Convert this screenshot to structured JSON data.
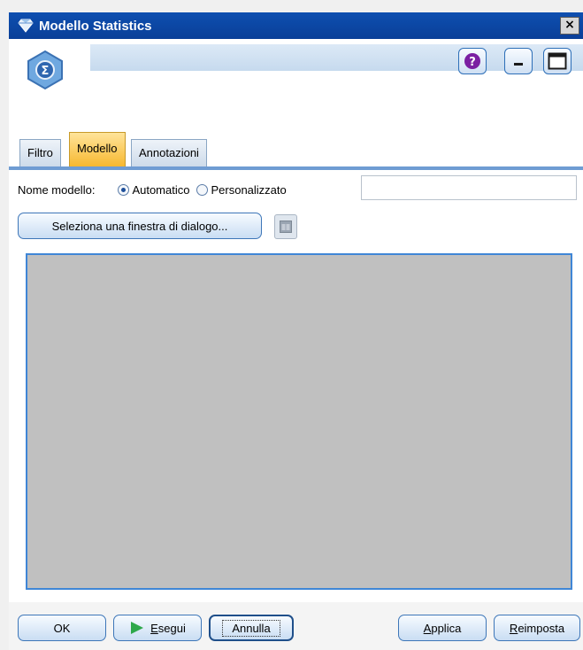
{
  "window": {
    "title": "Modello Statistics",
    "close_glyph": "×"
  },
  "header": {
    "node_icon": "sigma-node-icon",
    "help_icon": "help-icon",
    "minimize_icon": "minimize-icon",
    "maximize_icon": "maximize-icon"
  },
  "tabs": [
    {
      "label": "Filtro",
      "active": false
    },
    {
      "label": "Modello",
      "active": true
    },
    {
      "label": "Annotazioni",
      "active": false
    }
  ],
  "model": {
    "name_label": "Nome modello:",
    "radio_auto": "Automatico",
    "radio_custom": "Personalizzato",
    "selected": "Automatico",
    "custom_name_value": "",
    "select_dialog_button": "Seleziona una finestra di dialogo..."
  },
  "footer": {
    "ok": "OK",
    "run_first": "E",
    "run_rest": "segui",
    "cancel": "Annulla",
    "apply_first": "A",
    "apply_rest": "pplica",
    "reset_first": "R",
    "reset_rest": "eimposta"
  },
  "colors": {
    "titlebar": "#0e4fb0",
    "active_tab": "#f7b830",
    "panel_border": "#3f86d6",
    "panel_fill": "#c0c0c0",
    "run_icon": "#2ea84a"
  }
}
